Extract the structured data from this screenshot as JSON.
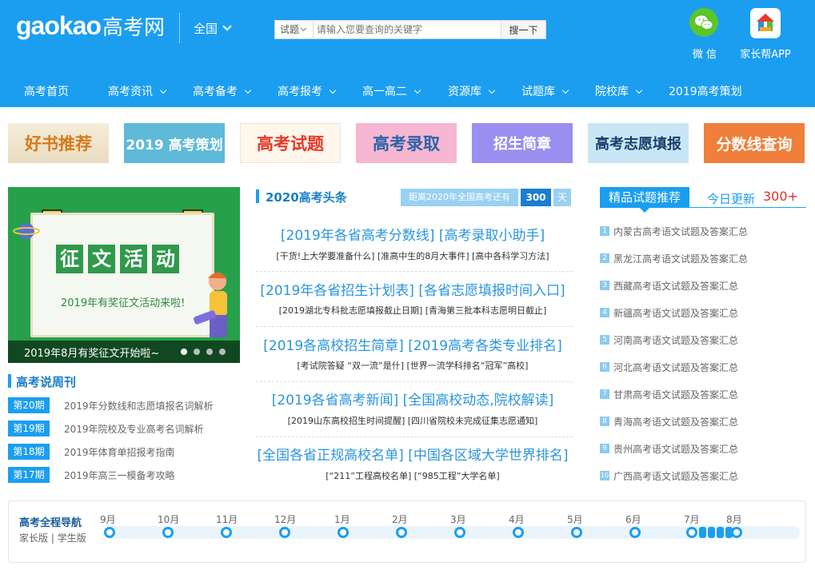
{
  "header": {
    "logo_latin": "gaokao",
    "logo_cn": "高考网",
    "region": "全国",
    "search": {
      "category": "试题",
      "placeholder": "请输入您要查询的关键字",
      "button": "搜一下"
    },
    "wechat_label": "微 信",
    "app_label": "家长帮APP",
    "nav": [
      "高考首页",
      "高考资讯",
      "高考备考",
      "高考报考",
      "高一高二",
      "资源库",
      "试题库",
      "院校库",
      "2019高考策划"
    ]
  },
  "banners": [
    "好书推荐",
    "2019 高考策划",
    "高考试题",
    "高考录取",
    "招生简章",
    "高考志愿填报",
    "分数线查询"
  ],
  "slider": {
    "title_chars": [
      "征",
      "文",
      "活",
      "动"
    ],
    "subtitle": "2019年有奖征文活动来啦!",
    "caption": "2019年8月有奖征文开始啦~"
  },
  "weekly": {
    "title": "高考说周刊",
    "items": [
      {
        "issue": "第20期",
        "title": "2019年分数线和志愿填报名词解析"
      },
      {
        "issue": "第19期",
        "title": "2019年院校及专业高考名词解析"
      },
      {
        "issue": "第18期",
        "title": "2019年体育单招报考指南"
      },
      {
        "issue": "第17期",
        "title": "2019年高三一模备考攻略"
      }
    ]
  },
  "headlines": {
    "title": "2020高考头条",
    "countdown_label": "距离2020年全国高考还有",
    "countdown_days": "300",
    "countdown_unit": "天",
    "items": [
      {
        "main": "[2019年各省高考分数线] [高考录取小助手]",
        "sub": "[干货!上大学要准备什么] [准高中生的8月大事件] [高中各科学习方法]"
      },
      {
        "main": "[2019年各省招生计划表] [各省志愿填报时间入口]",
        "sub": "[2019湖北专科批志愿填报截止日期] [青海第三批本科志愿明日截止]"
      },
      {
        "main": "[2019各高校招生简章] [2019高考各类专业排名]",
        "sub": "[考试院答疑 “双一流”是什] [世界一流学科排名“冠军”高校]"
      },
      {
        "main": "[2019各省高考新闻] [全国高校动态,院校解读]",
        "sub": "[2019山东高校招生时间提醒] [四川省院校未完成征集志愿通知]"
      },
      {
        "main": "[全国各省正规高校名单] [中国各区域大学世界排名]",
        "sub": "[“211”工程高校名单] [“985工程”大学名单]"
      }
    ]
  },
  "recommend": {
    "title": "精品试题推荐",
    "today_label": "今日更新",
    "today_count": "300+",
    "items": [
      "内蒙古高考语文试题及答案汇总",
      "黑龙江高考语文试题及答案汇总",
      "西藏高考语文试题及答案汇总",
      "新疆高考语文试题及答案汇总",
      "河南高考语文试题及答案汇总",
      "河北高考语文试题及答案汇总",
      "甘肃高考语文试题及答案汇总",
      "青海高考语文试题及答案汇总",
      "贵州高考语文试题及答案汇总",
      "广西高考语文试题及答案汇总"
    ],
    "numbers": [
      "1",
      "2",
      "3",
      "4",
      "5",
      "6",
      "7",
      "8",
      "9",
      "10"
    ]
  },
  "timeline": {
    "title": "高考全程导航",
    "parent": "家长版",
    "sep": "|",
    "student": "学生版",
    "months": [
      "9月",
      "10月",
      "11月",
      "12月",
      "1月",
      "2月",
      "3月",
      "4月",
      "5月",
      "6月",
      "7月",
      "8月"
    ]
  },
  "colors": {
    "brand": "#1b9ef0",
    "accent_red": "#e0322b",
    "slider_green": "#26a04a"
  },
  "icons": {
    "wechat": "wechat-icon",
    "app": "house-app-icon",
    "chevron": "chevron-down-icon"
  }
}
